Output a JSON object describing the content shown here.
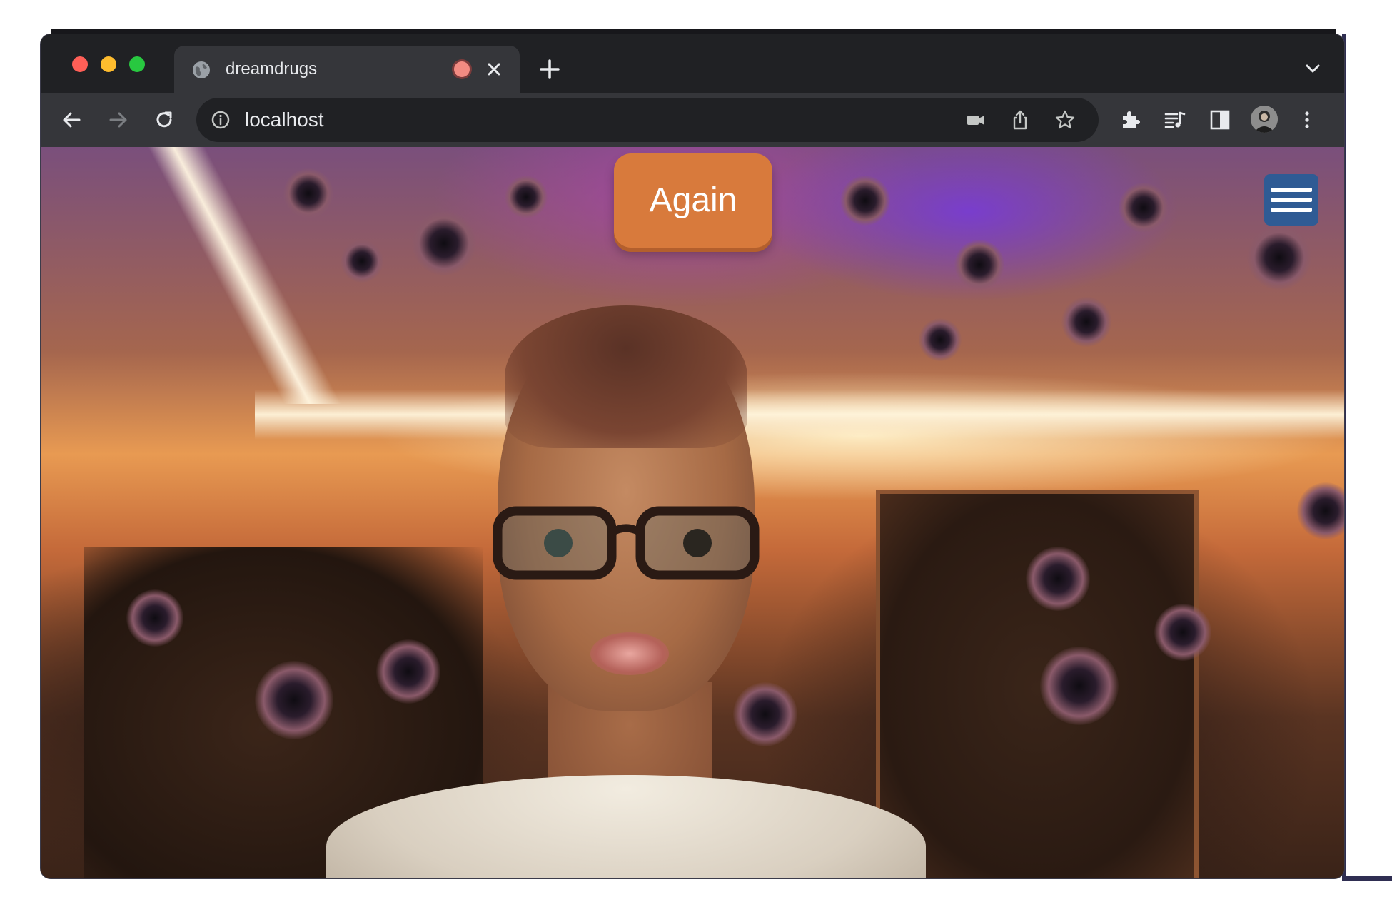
{
  "browser": {
    "tab_title": "dreamdrugs",
    "address": "localhost",
    "icons": {
      "tab_favicon": "globe-icon",
      "recording": "recording-indicator-icon",
      "tab_close": "close-icon",
      "new_tab": "plus-icon",
      "tab_search": "chevron-down-icon",
      "back": "back-arrow-icon",
      "forward": "forward-arrow-icon",
      "reload": "reload-icon",
      "site_info": "info-icon",
      "camera": "camera-icon",
      "share": "share-icon",
      "bookmark": "star-icon",
      "extensions": "puzzle-icon",
      "media": "media-control-icon",
      "side_panel": "side-panel-icon",
      "profile": "avatar",
      "menu": "kebab-menu-icon"
    }
  },
  "page": {
    "again_label": "Again",
    "menu_icon": "hamburger-menu-icon",
    "colors": {
      "again_button": "#d87a3c",
      "menu_button": "#2f5b94"
    }
  }
}
